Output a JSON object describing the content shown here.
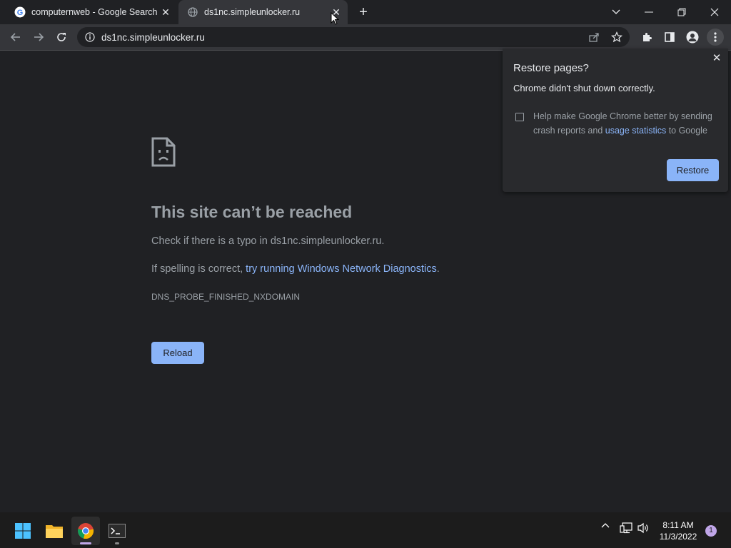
{
  "tabs": [
    {
      "title": "computernweb - Google Search",
      "favicon": "google-g-icon"
    },
    {
      "title": "ds1nc.simpleunlocker.ru",
      "favicon": "globe-icon"
    }
  ],
  "toolbar": {
    "url": "ds1nc.simpleunlocker.ru"
  },
  "error_page": {
    "title": "This site can’t be reached",
    "line1": "Check if there is a typo in ds1nc.simpleunlocker.ru.",
    "line2_prefix": "If spelling is correct, ",
    "line2_link": "try running Windows Network Diagnostics",
    "line2_suffix": ".",
    "error_code": "DNS_PROBE_FINISHED_NXDOMAIN",
    "reload_label": "Reload"
  },
  "restore_bubble": {
    "title": "Restore pages?",
    "subtitle": "Chrome didn't shut down correctly.",
    "checkbox_text_prefix": "Help make Google Chrome better by sending crash reports and ",
    "checkbox_link": "usage statistics",
    "checkbox_text_suffix": " to Google",
    "checkbox_checked": false,
    "restore_label": "Restore"
  },
  "taskbar": {
    "time": "8:11 AM",
    "date": "11/3/2022",
    "notification_count": "1"
  },
  "colors": {
    "accent": "#8ab4f8",
    "background": "#202124",
    "toolbar": "#35363a"
  }
}
